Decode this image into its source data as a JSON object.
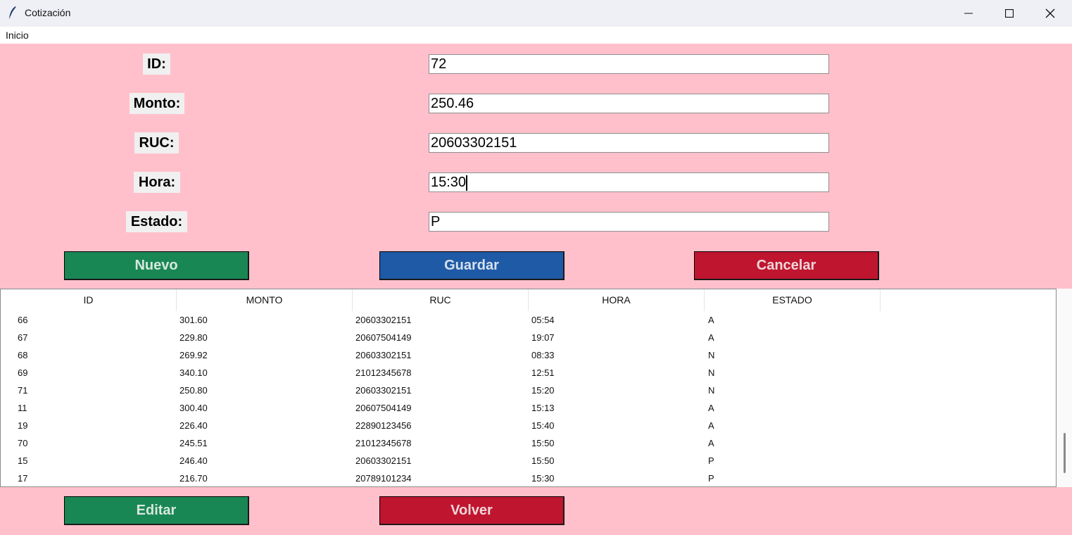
{
  "window": {
    "title": "Cotización"
  },
  "menu": {
    "inicio": "Inicio"
  },
  "form": {
    "id_label": "ID:",
    "id_value": "72",
    "monto_label": "Monto:",
    "monto_value": "250.46",
    "ruc_label": "RUC:",
    "ruc_value": "20603302151",
    "hora_label": "Hora:",
    "hora_value": "15:30",
    "estado_label": "Estado:",
    "estado_value": "P"
  },
  "buttons": {
    "nuevo": "Nuevo",
    "guardar": "Guardar",
    "cancelar": "Cancelar",
    "editar": "Editar",
    "volver": "Volver"
  },
  "table": {
    "columns": [
      "ID",
      "MONTO",
      "RUC",
      "HORA",
      "ESTADO"
    ],
    "rows": [
      [
        "66",
        "301.60",
        "20603302151",
        "05:54",
        "A"
      ],
      [
        "67",
        "229.80",
        "20607504149",
        "19:07",
        "A"
      ],
      [
        "68",
        "269.92",
        "20603302151",
        "08:33",
        "N"
      ],
      [
        "69",
        "340.10",
        "21012345678",
        "12:51",
        "N"
      ],
      [
        "71",
        "250.80",
        "20603302151",
        "15:20",
        "N"
      ],
      [
        "11",
        "300.40",
        "20607504149",
        "15:13",
        "A"
      ],
      [
        "19",
        "226.40",
        "22890123456",
        "15:40",
        "A"
      ],
      [
        "70",
        "245.51",
        "21012345678",
        "15:50",
        "A"
      ],
      [
        "15",
        "246.40",
        "20603302151",
        "15:50",
        "P"
      ],
      [
        "17",
        "216.70",
        "20789101234",
        "15:30",
        "P"
      ]
    ]
  },
  "colors": {
    "background": "#ffc0cb",
    "green": "#198754",
    "blue": "#1e5aa6",
    "red": "#c0152f"
  }
}
